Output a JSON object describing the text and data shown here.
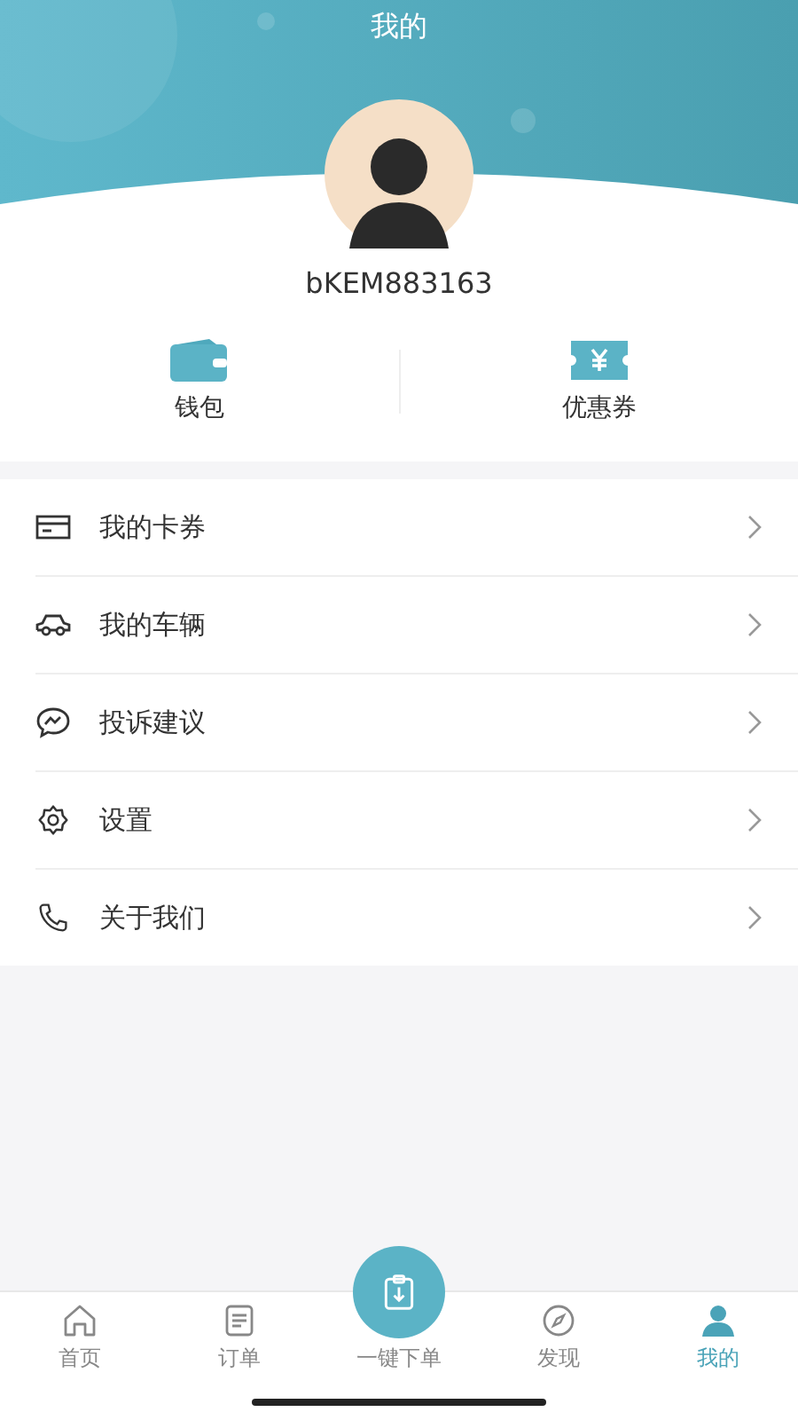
{
  "header": {
    "title": "我的",
    "username": "bKEM883163"
  },
  "quick_actions": [
    {
      "label": "钱包"
    },
    {
      "label": "优惠券"
    }
  ],
  "menu": [
    {
      "label": "我的卡券"
    },
    {
      "label": "我的车辆"
    },
    {
      "label": "投诉建议"
    },
    {
      "label": "设置"
    },
    {
      "label": "关于我们"
    }
  ],
  "tab_bar": [
    {
      "label": "首页",
      "kind": "tab",
      "selected": false
    },
    {
      "label": "订单",
      "kind": "tab",
      "selected": false
    },
    {
      "label": "一键下单",
      "kind": "center",
      "selected": false
    },
    {
      "label": "发现",
      "kind": "tab",
      "selected": false
    },
    {
      "label": "我的",
      "kind": "tab",
      "selected": true
    }
  ]
}
